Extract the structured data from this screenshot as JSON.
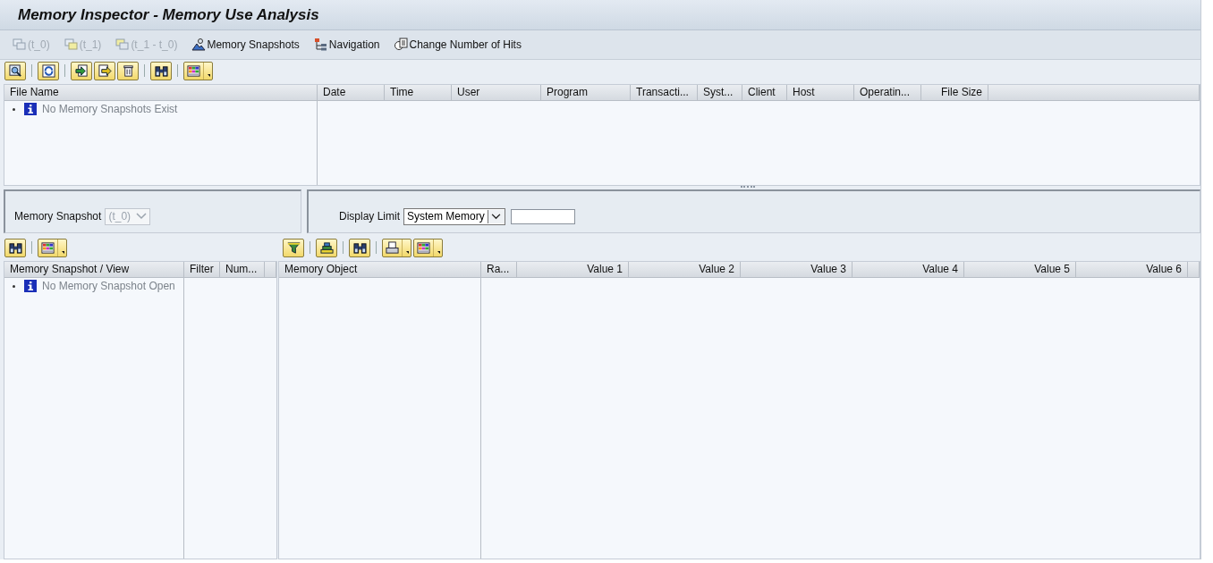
{
  "window": {
    "title": "Memory Inspector - Memory Use Analysis"
  },
  "app_toolbar": [
    {
      "label": "(t_0)",
      "kind": "snap0",
      "disabled": true
    },
    {
      "label": "(t_1)",
      "kind": "snap1",
      "disabled": true
    },
    {
      "label": "(t_1 - t_0)",
      "kind": "diff",
      "disabled": true
    },
    {
      "label": "Memory Snapshots",
      "kind": "mountain",
      "disabled": false
    },
    {
      "label": "Navigation",
      "kind": "tree",
      "disabled": false
    },
    {
      "label": "Change Number of Hits",
      "kind": "hits",
      "disabled": false
    }
  ],
  "top_toolbar": [
    {
      "kind": "details",
      "menu": false
    },
    {
      "kind": "refresh",
      "menu": false
    },
    {
      "kind": "import",
      "menu": false
    },
    {
      "kind": "export",
      "menu": false
    },
    {
      "kind": "delete",
      "menu": false
    },
    {
      "kind": "find",
      "menu": false
    },
    {
      "kind": "layout",
      "menu": true
    }
  ],
  "files_table": {
    "tree_column": "File Name",
    "tree_message": "No Memory Snapshots Exist",
    "columns": [
      {
        "label": "Date",
        "right_aligned": false
      },
      {
        "label": "Time",
        "right_aligned": false
      },
      {
        "label": "User",
        "right_aligned": false
      },
      {
        "label": "Program",
        "right_aligned": false
      },
      {
        "label": "Transacti...",
        "right_aligned": false
      },
      {
        "label": "Syst...",
        "right_aligned": false
      },
      {
        "label": "Client",
        "right_aligned": false
      },
      {
        "label": "Host",
        "right_aligned": false
      },
      {
        "label": "Operatin...",
        "right_aligned": false
      },
      {
        "label": "File Size",
        "right_aligned": true
      }
    ]
  },
  "snapshot_selector": {
    "label": "Memory Snapshot",
    "value": "(t_0)",
    "disabled": true
  },
  "display_limit": {
    "label": "Display Limit",
    "value": "System Memory"
  },
  "left_toolbar": [
    {
      "kind": "find",
      "menu": false
    },
    {
      "kind": "layout",
      "menu": true
    }
  ],
  "right_toolbar": [
    {
      "kind": "filter",
      "menu": false
    },
    {
      "kind": "sum",
      "menu": false
    },
    {
      "kind": "find",
      "menu": false
    },
    {
      "kind": "print",
      "menu": true
    },
    {
      "kind": "layout",
      "menu": true
    }
  ],
  "views_table": {
    "tree_column": "Memory Snapshot / View",
    "tree_message": "No Memory Snapshot Open",
    "columns": [
      {
        "label": "Filter",
        "right_aligned": false
      },
      {
        "label": "Num...",
        "right_aligned": false
      }
    ]
  },
  "objects_table": {
    "columns": [
      {
        "label": "Memory Object",
        "right_aligned": false
      },
      {
        "label": "Ra...",
        "right_aligned": false
      },
      {
        "label": "Value 1",
        "right_aligned": true
      },
      {
        "label": "Value 2",
        "right_aligned": true
      },
      {
        "label": "Value 3",
        "right_aligned": true
      },
      {
        "label": "Value 4",
        "right_aligned": true
      },
      {
        "label": "Value 5",
        "right_aligned": true
      },
      {
        "label": "Value 6",
        "right_aligned": true
      }
    ]
  }
}
